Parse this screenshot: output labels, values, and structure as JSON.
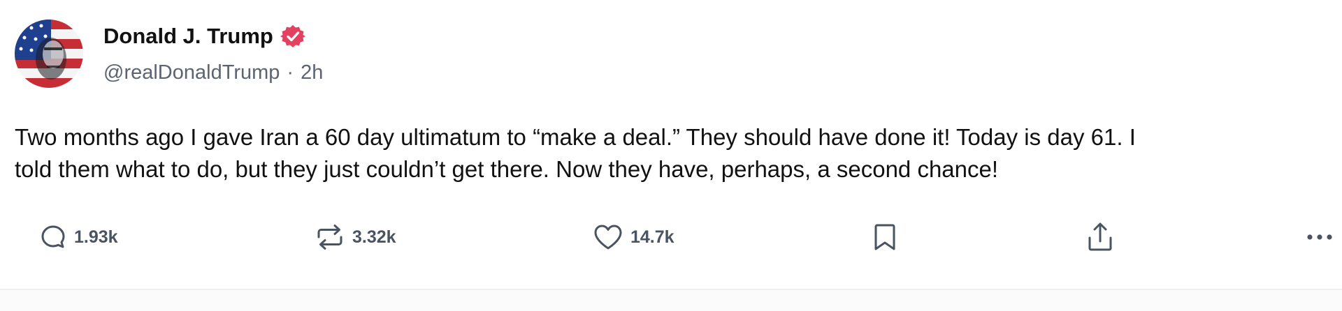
{
  "author": {
    "display_name": "Donald J. Trump",
    "handle": "@realDonaldTrump",
    "separator": "·",
    "time_ago": "2h",
    "verified": true,
    "verified_color": "#e4405f",
    "avatar": "avatar-image"
  },
  "post": {
    "lines": [
      "Two months ago I gave Iran a 60 day ultimatum to “make a deal.” They should have done it! Today is day 61. I",
      "told them what to do, but they just couldn’t get there. Now they have, perhaps, a second chance!"
    ]
  },
  "actions": {
    "reply": {
      "icon": "reply-icon",
      "count": "1.93k"
    },
    "repost": {
      "icon": "repost-icon",
      "count": "3.32k"
    },
    "like": {
      "icon": "heart-icon",
      "count": "14.7k"
    },
    "bookmark": {
      "icon": "bookmark-icon"
    },
    "share": {
      "icon": "share-icon"
    },
    "more": {
      "icon": "more-icon"
    }
  },
  "colors": {
    "text": "#111111",
    "muted": "#5b6470",
    "icon": "#4a5360",
    "accent": "#e4405f"
  }
}
